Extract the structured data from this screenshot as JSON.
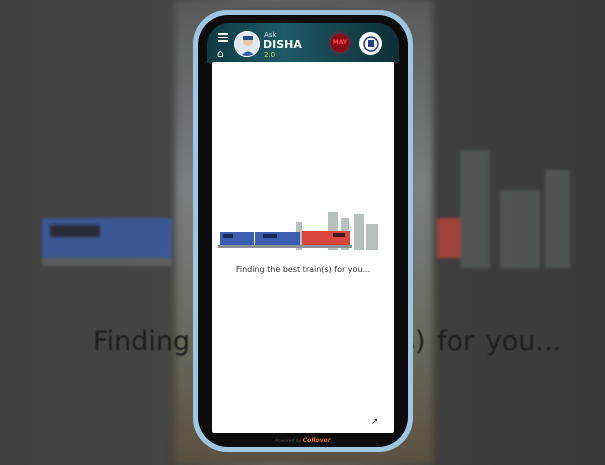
{
  "header": {
    "ask": "Ask",
    "name": "DISHA",
    "version": "2.0",
    "badge": "MAY"
  },
  "main": {
    "loading_text": "Finding the best train(s) for you..."
  },
  "footer": {
    "powered_by": "Powered by",
    "brand": "CoRover"
  },
  "background": {
    "text": "Finding the best train(s) for you..."
  },
  "colors": {
    "header": "#1c5a66",
    "frame": "#9fc6e0",
    "train_blue": "#3a5fb0",
    "train_red": "#d9473c"
  }
}
